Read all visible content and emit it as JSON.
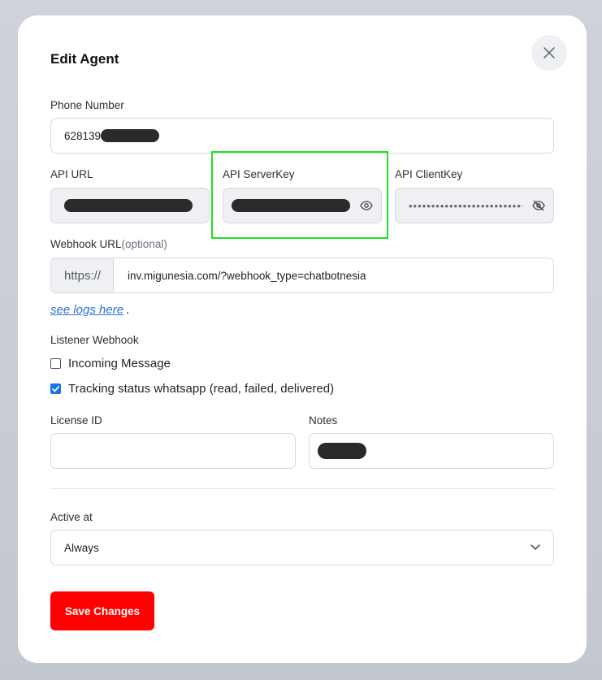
{
  "modal": {
    "title": "Edit Agent"
  },
  "phone": {
    "label": "Phone Number",
    "value_visible": "628139"
  },
  "api_url": {
    "label": "API URL"
  },
  "api_server_key": {
    "label": "API ServerKey"
  },
  "api_client_key": {
    "label": "API ClientKey",
    "masked_value": "••••••••••••••••••••••••••••••••••••••••••"
  },
  "webhook": {
    "label": "Webhook URL",
    "optional_label": "(optional)",
    "prefix": "https://",
    "value": "inv.migunesia.com/?webhook_type=chatbotnesia",
    "logs_link": "see logs here",
    "logs_suffix": "."
  },
  "listener": {
    "label": "Listener Webhook",
    "options": [
      {
        "label": "Incoming Message",
        "checked": false
      },
      {
        "label": "Tracking status whatsapp (read, failed, delivered)",
        "checked": true
      }
    ]
  },
  "license": {
    "label": "License ID",
    "value": ""
  },
  "notes": {
    "label": "Notes"
  },
  "active_at": {
    "label": "Active at",
    "selected": "Always"
  },
  "actions": {
    "save_label": "Save Changes"
  },
  "colors": {
    "save_button": "#ff0000",
    "checkbox_checked": "#1a73e8",
    "highlight": "#22e01e",
    "link": "#2d6fd8"
  },
  "icons": {
    "close": "close-icon",
    "show_password": "eye-icon",
    "hide_password": "eye-off-icon",
    "select": "chevron-down-icon"
  }
}
